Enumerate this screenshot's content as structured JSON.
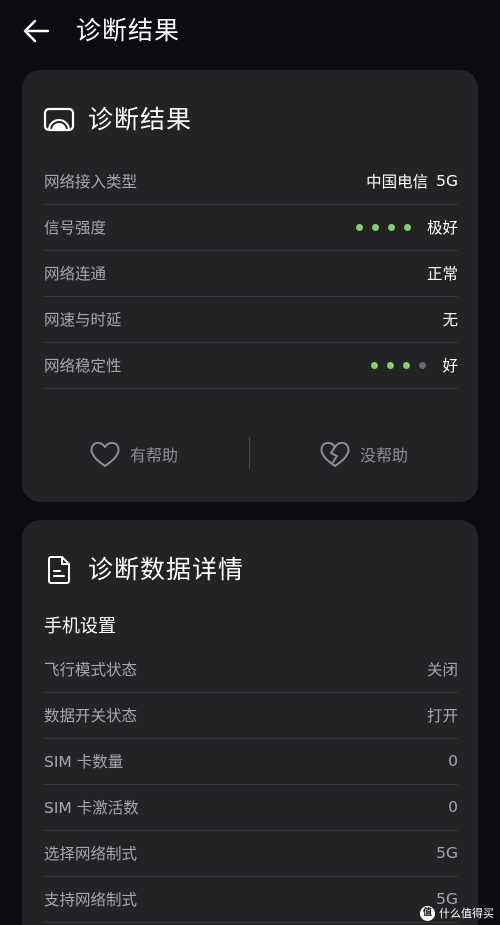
{
  "header": {
    "title": "诊断结果"
  },
  "result_card": {
    "title": "诊断结果",
    "rows": [
      {
        "label": "网络接入类型",
        "carrier": "中国电信",
        "value": "5G"
      },
      {
        "label": "信号强度",
        "value": "极好",
        "level": 4,
        "max": 4
      },
      {
        "label": "网络连通",
        "value": "正常"
      },
      {
        "label": "网速与时延",
        "value": "无"
      },
      {
        "label": "网络稳定性",
        "value": "好",
        "level": 3,
        "max": 4
      }
    ],
    "helpful_label": "有帮助",
    "unhelpful_label": "没帮助"
  },
  "detail_card": {
    "title": "诊断数据详情",
    "section_title": "手机设置",
    "rows": [
      {
        "label": "飞行模式状态",
        "value": "关闭"
      },
      {
        "label": "数据开关状态",
        "value": "打开"
      },
      {
        "label": "SIM 卡数量",
        "value": "0"
      },
      {
        "label": "SIM 卡激活数",
        "value": "0"
      },
      {
        "label": "选择网络制式",
        "value": "5G"
      },
      {
        "label": "支持网络制式",
        "value": "5G"
      }
    ]
  },
  "watermark": {
    "badge": "值",
    "text": "什么值得买"
  },
  "colors": {
    "background": "#0b0b12",
    "card": "#232326",
    "dot_active": "#7bd36a",
    "dot_inactive": "#6c6c70"
  }
}
